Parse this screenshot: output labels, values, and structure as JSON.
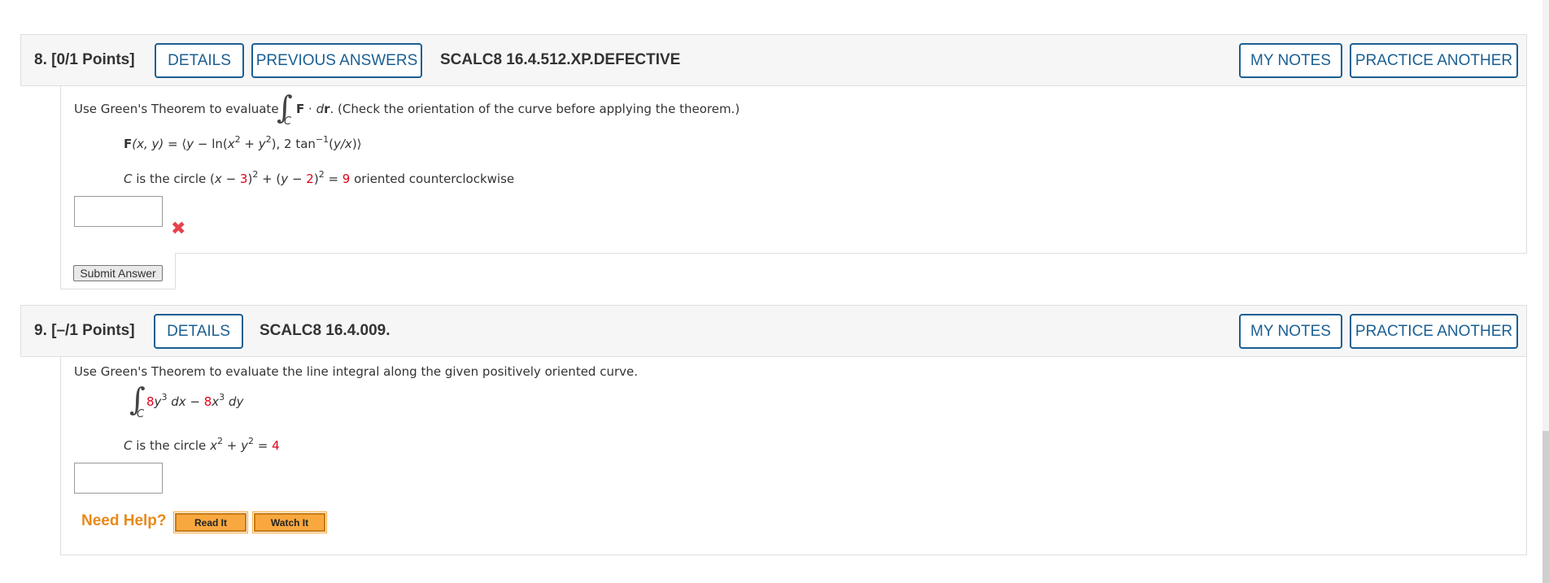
{
  "q8": {
    "number": "8.",
    "points": "[0/1 Points]",
    "details": "DETAILS",
    "previous_answers": "PREVIOUS ANSWERS",
    "code": "SCALC8 16.4.512.XP.DEFECTIVE",
    "my_notes": "MY NOTES",
    "practice_another": "PRACTICE ANOTHER",
    "prompt_before": "Use Green's Theorem to evaluate",
    "integral_symbol": "∫",
    "integral_sub": "C",
    "integrand_F": "F",
    "integrand_dot": " · ",
    "integrand_d": "d",
    "integrand_r": "r",
    "prompt_after": ".  (Check the orientation of the curve before applying the theorem.)",
    "field_F": "F",
    "field_vars": "(x, y)",
    "field_eq": " = ⟨",
    "field_y": "y",
    "field_mid": " − ln(",
    "field_x2": "x",
    "field_sq1": "2",
    "field_plus": " + ",
    "field_y2": "y",
    "field_sq2": "2",
    "field_rest": "), 2 tan",
    "field_inv": "−1",
    "field_paren_open": "(",
    "field_yx": "y/x",
    "field_end": ")⟩",
    "curve_C": "C",
    "curve_text1": " is the circle (",
    "curve_x": "x",
    "curve_minus1": " − ",
    "curve_h": "3",
    "curve_close1": ")",
    "curve_sq1": "2",
    "curve_plus": " + (",
    "curve_y": "y",
    "curve_minus2": " − ",
    "curve_k": "2",
    "curve_close2": ")",
    "curve_sq2": "2",
    "curve_eq": " = ",
    "curve_r2": "9",
    "curve_text2": " oriented counterclockwise",
    "answer_value": "",
    "incorrect_mark": "✖",
    "submit": "Submit Answer"
  },
  "q9": {
    "number": "9.",
    "points": "[–/1 Points]",
    "details": "DETAILS",
    "code": "SCALC8 16.4.009.",
    "my_notes": "MY NOTES",
    "practice_another": "PRACTICE ANOTHER",
    "prompt": "Use Green's Theorem to evaluate the line integral along the given positively oriented curve.",
    "integral_symbol": "∫",
    "integral_sub": "C",
    "coef1": "8",
    "var_y": "y",
    "exp1": "3",
    "dx": " dx",
    "minus": " − ",
    "coef2": "8",
    "var_x": "x",
    "exp2": "3",
    "dy": " dy",
    "curve_C": "C",
    "curve_text": " is the circle ",
    "curve_x": "x",
    "curve_sq1": "2",
    "curve_plus": " + ",
    "curve_y": "y",
    "curve_sq2": "2",
    "curve_eq": " = ",
    "curve_r2": "4",
    "answer_value": "",
    "need_help": "Need Help?",
    "read_it": "Read It",
    "watch_it": "Watch It"
  }
}
